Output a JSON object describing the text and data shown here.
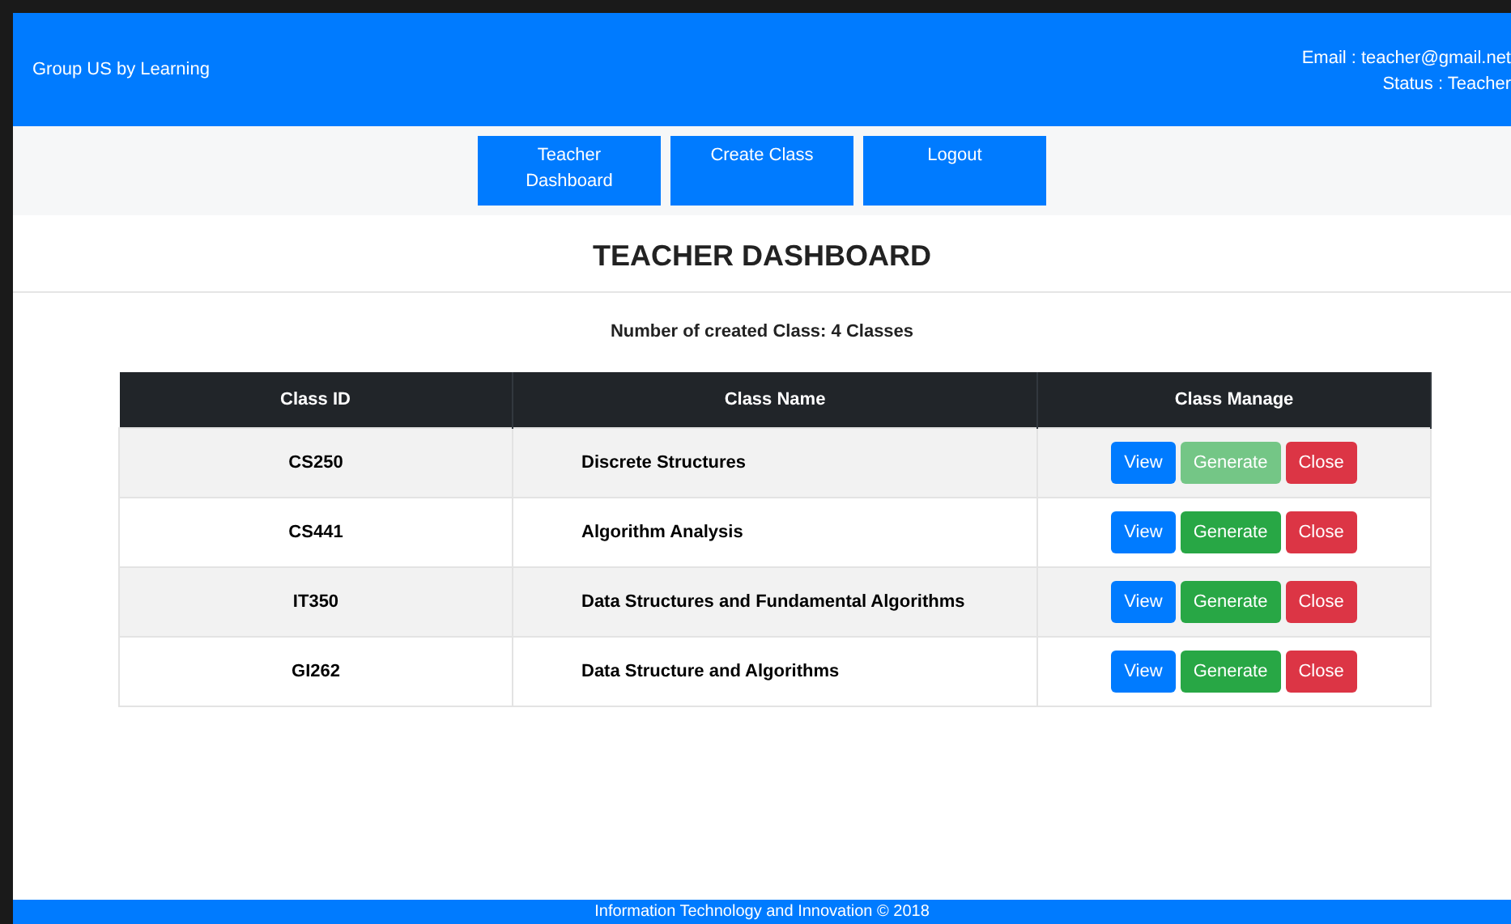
{
  "header": {
    "brand": "Group US by Learning",
    "email": "Email : teacher@gmail.net",
    "status": "Status : Teacher"
  },
  "nav": [
    "Teacher Dashboard",
    "Create Class",
    "Logout"
  ],
  "title": "TEACHER DASHBOARD",
  "summary": "Number of created Class: 4 Classes",
  "table": {
    "columns": [
      "Class ID",
      "Class Name",
      "Class Manage"
    ],
    "rows": [
      {
        "id": "CS250",
        "name": "Discrete Structures",
        "actions": [
          {
            "label": "View",
            "kind": "primary",
            "disabled": false
          },
          {
            "label": "Generate",
            "kind": "success",
            "disabled": true
          },
          {
            "label": "Close",
            "kind": "danger",
            "disabled": false
          }
        ]
      },
      {
        "id": "CS441",
        "name": "Algorithm Analysis",
        "actions": [
          {
            "label": "View",
            "kind": "primary",
            "disabled": false
          },
          {
            "label": "Generate",
            "kind": "success",
            "disabled": false
          },
          {
            "label": "Close",
            "kind": "danger",
            "disabled": false
          }
        ]
      },
      {
        "id": "IT350",
        "name": "Data Structures and Fundamental Algorithms",
        "actions": [
          {
            "label": "View",
            "kind": "primary",
            "disabled": false
          },
          {
            "label": "Generate",
            "kind": "success",
            "disabled": false
          },
          {
            "label": "Close",
            "kind": "danger",
            "disabled": false
          }
        ]
      },
      {
        "id": "GI262",
        "name": "Data Structure and Algorithms",
        "actions": [
          {
            "label": "View",
            "kind": "primary",
            "disabled": false
          },
          {
            "label": "Generate",
            "kind": "success",
            "disabled": false
          },
          {
            "label": "Close",
            "kind": "danger",
            "disabled": false
          }
        ]
      }
    ]
  },
  "footer": "Information Technology and Innovation © 2018"
}
